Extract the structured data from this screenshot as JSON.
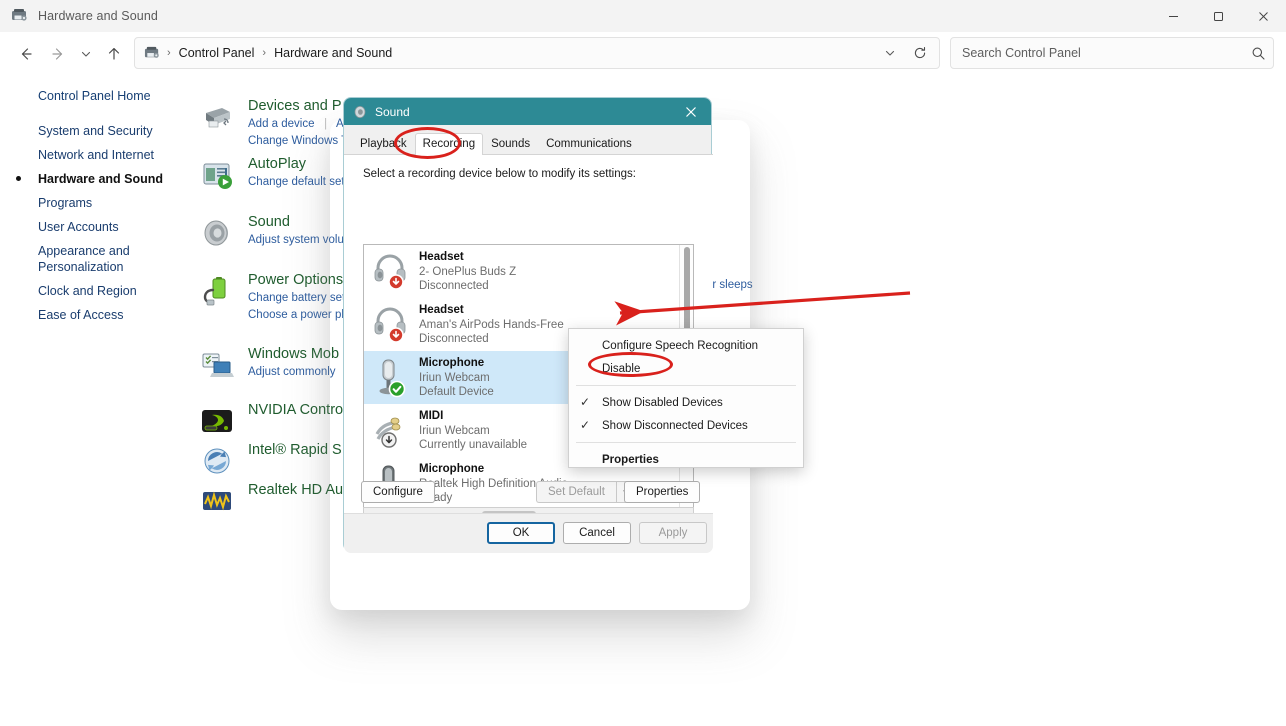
{
  "window": {
    "title": "Hardware and Sound",
    "icon": "control-panel-icon",
    "minimize_label": "Minimize",
    "maximize_label": "Maximize",
    "close_label": "Close"
  },
  "nav": {
    "back_label": "Back",
    "forward_label": "Forward",
    "recent_label": "Recent locations",
    "up_label": "Up",
    "refresh_label": "Refresh",
    "history_label": "Previous locations",
    "breadcrumbs": [
      "Control Panel",
      "Hardware and Sound"
    ],
    "separator": "›"
  },
  "search": {
    "placeholder": "Search Control Panel",
    "value": "",
    "icon": "search-icon"
  },
  "sidebar": {
    "home": "Control Panel Home",
    "items": [
      {
        "label": "System and Security",
        "active": false
      },
      {
        "label": "Network and Internet",
        "active": false
      },
      {
        "label": "Hardware and Sound",
        "active": true
      },
      {
        "label": "Programs",
        "active": false
      },
      {
        "label": "User Accounts",
        "active": false
      },
      {
        "label": "Appearance and\nPersonalization",
        "active": false
      },
      {
        "label": "Clock and Region",
        "active": false
      },
      {
        "label": "Ease of Access",
        "active": false
      }
    ]
  },
  "content": {
    "items": [
      {
        "icon": "printer-icon",
        "title": "Devices and P",
        "links": [
          "Add a device",
          "A",
          "Change Windows T"
        ]
      },
      {
        "icon": "autoplay-icon",
        "title": "AutoPlay",
        "links": [
          "Change default set"
        ]
      },
      {
        "icon": "speaker-icon",
        "title": "Sound",
        "links": [
          "Adjust system volu"
        ]
      },
      {
        "icon": "power-icon",
        "title": "Power Options",
        "links": [
          "Change battery set",
          "Choose a power pl"
        ]
      },
      {
        "icon": "mobility-icon",
        "title": "Windows Mob",
        "links": [
          "Adjust commonly"
        ]
      },
      {
        "icon": "nvidia-icon",
        "title": "NVIDIA Contro",
        "links": []
      },
      {
        "icon": "intel-icon",
        "title": "Intel® Rapid S",
        "links": []
      },
      {
        "icon": "realtek-icon",
        "title": "Realtek HD Au",
        "links": []
      }
    ],
    "occluded_text": "er sleeps"
  },
  "dialog": {
    "title": "Sound",
    "icon": "sound-icon",
    "close_label": "Close",
    "tabs": [
      {
        "label": "Playback",
        "active": false
      },
      {
        "label": "Recording",
        "active": true
      },
      {
        "label": "Sounds",
        "active": false
      },
      {
        "label": "Communications",
        "active": false
      }
    ],
    "hint": "Select a recording device below to modify its settings:",
    "devices": [
      {
        "name": "Headset",
        "description": "2- OnePlus Buds Z",
        "status": "Disconnected",
        "icon": "headset-icon",
        "badge": "disconnected-arrow-badge",
        "selected": false
      },
      {
        "name": "Headset",
        "description": "Aman's AirPods Hands-Free",
        "status": "Disconnected",
        "icon": "headset-icon",
        "badge": "disconnected-arrow-badge",
        "selected": false
      },
      {
        "name": "Microphone",
        "description": "Iriun Webcam",
        "status": "Default Device",
        "icon": "microphone-icon",
        "badge": "default-device-check-badge",
        "selected": true
      },
      {
        "name": "MIDI",
        "description": "Iriun Webcam",
        "status": "Currently unavailable",
        "icon": "midi-icon",
        "badge": "unavailable-arrow-badge",
        "selected": false
      },
      {
        "name": "Microphone",
        "description": "Realtek High Definition Audio",
        "status": "Ready",
        "icon": "microphone-icon",
        "badge": "none",
        "selected": false
      }
    ],
    "buttons": {
      "configure": "Configure",
      "set_default": "Set Default",
      "set_default_arrow": "▾",
      "properties": "Properties",
      "ok": "OK",
      "cancel": "Cancel",
      "apply": "Apply"
    }
  },
  "context_menu": {
    "items": [
      {
        "label": "Configure Speech Recognition",
        "checked": false,
        "bold": false
      },
      {
        "label": "Disable",
        "checked": false,
        "bold": false
      },
      {
        "label": "Show Disabled Devices",
        "checked": true,
        "bold": false
      },
      {
        "label": "Show Disconnected Devices",
        "checked": true,
        "bold": false
      },
      {
        "label": "Properties",
        "checked": false,
        "bold": true
      }
    ],
    "check_glyph": "✓"
  },
  "annotations": {
    "highlight_color": "#d9211c",
    "tab_circle_target": "Recording",
    "menu_circle_target": "Disable",
    "arrow_target": "Microphone Iriun Webcam row"
  }
}
